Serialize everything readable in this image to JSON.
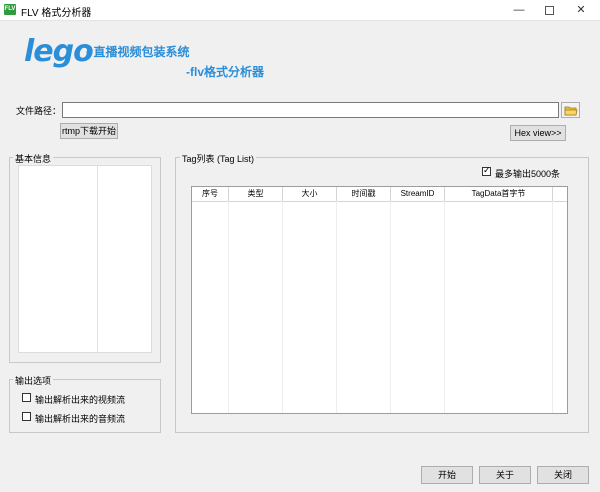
{
  "window": {
    "title": "FLV 格式分析器",
    "app_icon_text": "FLV",
    "min_glyph": "—",
    "close_glyph": "✕"
  },
  "logo": {
    "brand": "lego",
    "line1": "• 直播视频包装系统",
    "line2": "-flv格式分析器"
  },
  "file": {
    "label": "文件路径：",
    "value": "",
    "rtmp_button": "rtmp下载开始",
    "hex_button": "Hex view>>"
  },
  "basic_info": {
    "title": "基本信息"
  },
  "output_options": {
    "title": "输出选项",
    "video_label": "输出解析出来的视频流",
    "video_checked": false,
    "audio_label": "输出解析出来的音频流",
    "audio_checked": false
  },
  "tag_list": {
    "title": "Tag列表 (Tag List)",
    "max_output_label": "最多输出5000条",
    "max_output_checked": true,
    "columns": [
      "序号",
      "类型",
      "大小",
      "时间戳",
      "StreamID",
      "TagData首字节"
    ]
  },
  "buttons": {
    "start": "开始",
    "about": "关于",
    "close": "关闭"
  },
  "colors": {
    "logo_blue": "#2a8ed8",
    "icon_green": "#2e9b3c"
  }
}
